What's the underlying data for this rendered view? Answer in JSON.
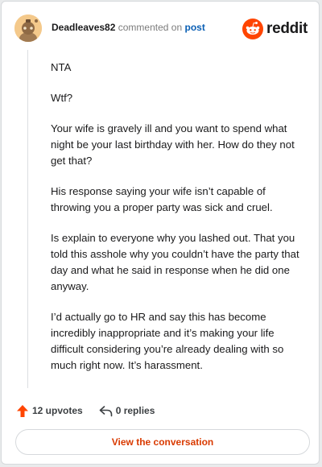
{
  "comment": {
    "author": "Deadleaves82",
    "commented_on_text": "commented on",
    "post_link_text": "post",
    "paragraphs": [
      "NTA",
      "Wtf?",
      "Your wife is gravely ill and you want to spend what night be your last birthday with her. How do they not get that?",
      "His response saying your wife isn’t capable of throwing you a proper party was sick and cruel.",
      "Is explain to everyone why you lashed out. That you told this asshole why you couldn’t have the party that day and what he said in response when he did one anyway.",
      "I’d actually go to HR and say this has become incredibly inappropriate and it’s making your life difficult considering you’re already dealing with so much right now. It’s harassment."
    ]
  },
  "brand": {
    "wordmark": "reddit",
    "logo_icon": "reddit-snoo-icon",
    "accent_color": "#ff4500"
  },
  "actions": {
    "upvotes_label": "12 upvotes",
    "replies_label": "0 replies",
    "upvote_icon": "upvote-arrow-icon",
    "reply_icon": "reply-arrow-icon",
    "upvote_color": "#ff4500"
  },
  "footer": {
    "view_button_label": "View the conversation",
    "view_button_color": "#d93a00"
  }
}
